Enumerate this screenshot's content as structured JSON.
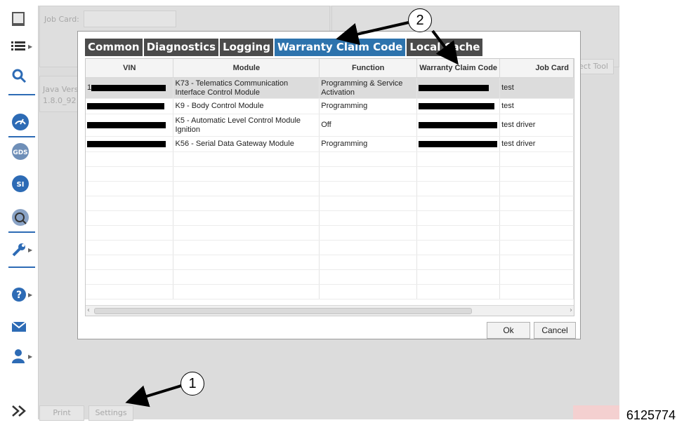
{
  "background": {
    "job_card_label": "Job Card:",
    "java_version_line1": "Java Vers",
    "java_version_line2": "1.8.0_92",
    "select_tool_button": "ect Tool",
    "print_button": "Print",
    "settings_button": "Settings"
  },
  "sidebar": {
    "items": [
      "window-icon",
      "list-icon",
      "search-icon",
      "gauge-icon",
      "gds-icon",
      "si-icon",
      "sps-icon",
      "wrench-icon",
      "help-icon",
      "mail-icon",
      "user-icon",
      "expand-icon"
    ]
  },
  "dialog": {
    "tabs": [
      {
        "label": "Common",
        "active": false
      },
      {
        "label": "Diagnostics",
        "active": false
      },
      {
        "label": "Logging",
        "active": false
      },
      {
        "label": "Warranty Claim Code",
        "active": true
      },
      {
        "label": "Local Cache",
        "active": false
      }
    ],
    "columns": [
      "VIN",
      "Module",
      "Function",
      "Warranty Claim Code",
      "Job Card"
    ],
    "rows": [
      {
        "vin": "1",
        "module": "K73 - Telematics Communication Interface Control Module",
        "function": "Programming & Service Activation",
        "job_card": "test"
      },
      {
        "vin": "",
        "module": "K9 - Body Control Module",
        "function": "Programming",
        "job_card": "test"
      },
      {
        "vin": "",
        "module": "K5 - Automatic Level Control Module Ignition",
        "function": "Off",
        "job_card": "test driver"
      },
      {
        "vin": "",
        "module": "K56 - Serial Data Gateway Module",
        "function": "Programming",
        "job_card": "test driver"
      }
    ],
    "ok_button": "Ok",
    "cancel_button": "Cancel"
  },
  "callouts": [
    "1",
    "2"
  ],
  "figure_number": "6125774",
  "colors": {
    "active_tab": "#2d73ad",
    "inactive_tab": "#4b4b4b",
    "sidebar_accent": "#2d6bb5"
  }
}
